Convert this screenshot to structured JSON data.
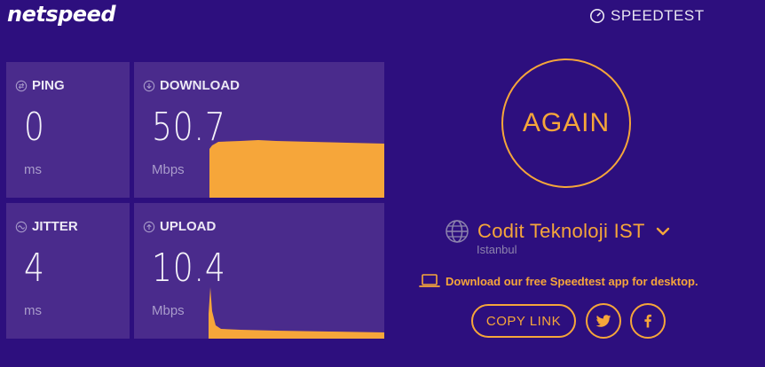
{
  "header": {
    "logo_text": "netspeed",
    "brand_text": "SPEEDTEST"
  },
  "metrics": {
    "ping": {
      "label": "PING",
      "value": "0",
      "unit": "ms"
    },
    "download": {
      "label": "DOWNLOAD",
      "value": "50.7",
      "unit": "Mbps"
    },
    "jitter": {
      "label": "JITTER",
      "value": "4",
      "unit": "ms"
    },
    "upload": {
      "label": "UPLOAD",
      "value": "10.4",
      "unit": "Mbps"
    }
  },
  "actions": {
    "again_label": "AGAIN",
    "copy_link_label": "COPY LINK"
  },
  "server": {
    "name": "Codit Teknoloji IST",
    "location": "Istanbul"
  },
  "promo_text": "Download our free Speedtest app for desktop.",
  "icons": {
    "brand": "gauge-icon",
    "ping": "ping-icon",
    "download": "download-icon",
    "jitter": "jitter-icon",
    "upload": "upload-icon",
    "server": "globe-icon",
    "dropdown": "chevron-down-icon",
    "promo": "laptop-icon",
    "twitter": "twitter-icon",
    "facebook": "facebook-icon"
  },
  "colors": {
    "background": "#2d0f7e",
    "panel": "#4a2b8c",
    "accent": "#f6a63a",
    "muted_text": "#a99ccb"
  }
}
